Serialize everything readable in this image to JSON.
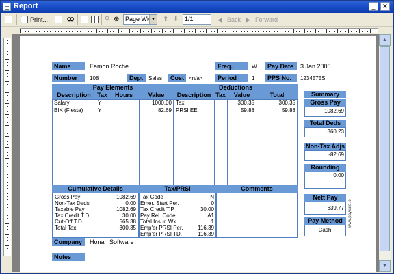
{
  "window": {
    "title": "Report"
  },
  "toolbar": {
    "print": "Print...",
    "zoom": "Page Wid",
    "page": "1/1",
    "back": "Back",
    "forward": "Forward"
  },
  "header": {
    "name_label": "Name",
    "name_value": "Eamon Roche",
    "freq_label": "Freq.",
    "freq_value": "W",
    "paydate_label": "Pay Date",
    "paydate_value": "3 Jan 2005",
    "number_label": "Number",
    "number_value": "108",
    "dept_label": "Dept",
    "dept_value": "Sales",
    "cost_label": "Cost",
    "cost_value": "<n/a>",
    "period_label": "Period",
    "period_value": "1",
    "pps_label": "PPS No.",
    "pps_value": "1234575S"
  },
  "pay_elements": {
    "title": "Pay Elements",
    "col_desc": "Description",
    "col_tax": "Tax",
    "col_hours": "Hours",
    "col_value": "Value",
    "rows": [
      {
        "desc": "Salary",
        "tax": "Y",
        "hours": "",
        "value": "1000.00"
      },
      {
        "desc": "BIK (Fiesta)",
        "tax": "Y",
        "hours": "",
        "value": "82.69"
      }
    ]
  },
  "deductions": {
    "title": "Deductions",
    "col_desc": "Description",
    "col_tax": "Tax",
    "col_value": "Value",
    "col_total": "Total",
    "rows": [
      {
        "desc": "Tax",
        "tax": "",
        "value": "300.35",
        "total": "300.35"
      },
      {
        "desc": "PRSI EE",
        "tax": "",
        "value": "59.88",
        "total": "59.88"
      }
    ]
  },
  "summary": {
    "title": "Summary",
    "gross_label": "Gross Pay",
    "gross_value": "1082.69",
    "totalded_label": "Total Deds",
    "totalded_value": "360.23",
    "nontax_label": "Non-Tax Adjs",
    "nontax_value": "-82.69",
    "rounding_label": "Rounding",
    "rounding_value": "0.00",
    "nett_label": "Nett Pay",
    "nett_value": "639.77",
    "method_label": "Pay Method",
    "method_value": "Cash"
  },
  "cumulative": {
    "title": "Cumulative Details",
    "rows": [
      {
        "label": "Gross Pay",
        "value": "1082.69"
      },
      {
        "label": "Non-Tax Deds",
        "value": "0.00"
      },
      {
        "label": "Taxable Pay",
        "value": "1082.69"
      },
      {
        "label": "Tax Credit T.D",
        "value": "30.00"
      },
      {
        "label": "Cut-Off T.D",
        "value": "565.38"
      },
      {
        "label": "Total Tax",
        "value": "300.35"
      }
    ]
  },
  "taxprsi": {
    "title": "Tax/PRSI",
    "rows": [
      {
        "label": "Tax Code",
        "value": "N"
      },
      {
        "label": "Emer. Start Per.",
        "value": "0"
      },
      {
        "label": "Tax Credit T.P",
        "value": "30.00"
      },
      {
        "label": "Pay Rel. Code",
        "value": "A1"
      },
      {
        "label": "Total Insur. Wk.",
        "value": "1"
      },
      {
        "label": "Emp'er PRSI Per.",
        "value": "116.39"
      },
      {
        "label": "Emp'er PRSI TD.",
        "value": "116.39"
      }
    ]
  },
  "comments": {
    "title": "Comments"
  },
  "company": {
    "label": "Company",
    "value": "Honan Software"
  },
  "notes": {
    "label": "Notes"
  },
  "watermark": "www.paysafe.ie"
}
